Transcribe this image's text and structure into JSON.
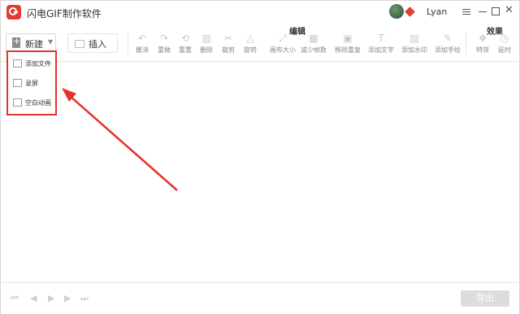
{
  "app": {
    "title": "闪电GIF制作软件",
    "username": "Lyan",
    "close_glyph": "✕"
  },
  "toolbar": {
    "new_label": "新建",
    "insert_label": "插入",
    "section_edit": "编辑",
    "section_effects": "效果",
    "edit_tools": [
      {
        "label": "撤消",
        "icon": "undo-icon",
        "glyph": "↶"
      },
      {
        "label": "重做",
        "icon": "redo-icon",
        "glyph": "↷"
      },
      {
        "label": "重置",
        "icon": "reset-icon",
        "glyph": "⟲"
      },
      {
        "label": "删除",
        "icon": "trash-icon",
        "glyph": "▥"
      },
      {
        "label": "裁剪",
        "icon": "scissors-icon",
        "glyph": "✂"
      },
      {
        "label": "旋转",
        "icon": "rotate-icon",
        "glyph": "△"
      },
      {
        "label": "画布大小",
        "icon": "canvas-size-icon",
        "glyph": "⤢"
      },
      {
        "label": "减少帧数",
        "icon": "reduce-frames-icon",
        "glyph": "▦"
      },
      {
        "label": "移除重复",
        "icon": "remove-duplicate-icon",
        "glyph": "▣"
      },
      {
        "label": "添加文字",
        "icon": "add-text-icon",
        "glyph": "T"
      },
      {
        "label": "添加水印",
        "icon": "add-watermark-icon",
        "glyph": "▨"
      },
      {
        "label": "添加手绘",
        "icon": "pen-icon",
        "glyph": "✎"
      }
    ],
    "effect_tools": [
      {
        "label": "特效",
        "icon": "effects-icon",
        "glyph": "❖"
      },
      {
        "label": "延时",
        "icon": "delay-icon",
        "glyph": "◷"
      }
    ]
  },
  "dropdown": {
    "items": [
      {
        "label": "添加文件",
        "icon": "add-file-icon"
      },
      {
        "label": "录屏",
        "icon": "screen-record-icon"
      },
      {
        "label": "空白动画",
        "icon": "blank-animation-icon"
      }
    ]
  },
  "bottom": {
    "controls": [
      {
        "icon": "first-frame-icon",
        "glyph": "⏮"
      },
      {
        "icon": "prev-frame-icon",
        "glyph": "◀"
      },
      {
        "icon": "play-icon",
        "glyph": "▶"
      },
      {
        "icon": "next-frame-icon",
        "glyph": "▶"
      },
      {
        "icon": "last-frame-icon",
        "glyph": "⏭"
      }
    ],
    "export_label": "导出"
  },
  "colors": {
    "accent_red": "#e5332a",
    "disabled_gray": "#dddddd"
  }
}
